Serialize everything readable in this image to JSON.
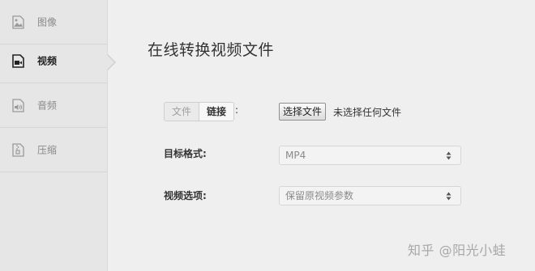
{
  "sidebar": {
    "items": [
      {
        "label": "图像",
        "icon": "image-icon",
        "active": false
      },
      {
        "label": "视频",
        "icon": "video-icon",
        "active": true
      },
      {
        "label": "音频",
        "icon": "audio-icon",
        "active": false
      },
      {
        "label": "压缩",
        "icon": "archive-icon",
        "active": false
      }
    ]
  },
  "main": {
    "title": "在线转换视频文件",
    "source_tabs": [
      {
        "label": "文件",
        "selected": false
      },
      {
        "label": "链接",
        "selected": true
      }
    ],
    "source_colon": ":",
    "file_button_label": "选择文件",
    "file_status": "未选择任何文件",
    "target_format": {
      "label": "目标格式:",
      "value": "MP4"
    },
    "video_options": {
      "label": "视频选项:",
      "value": "保留原视频参数"
    }
  },
  "watermark": "知乎 @阳光小蛙",
  "colors": {
    "sidebar_bg": "#e6e6e6",
    "page_bg": "#efefef",
    "text_muted": "#8a8a8a"
  }
}
